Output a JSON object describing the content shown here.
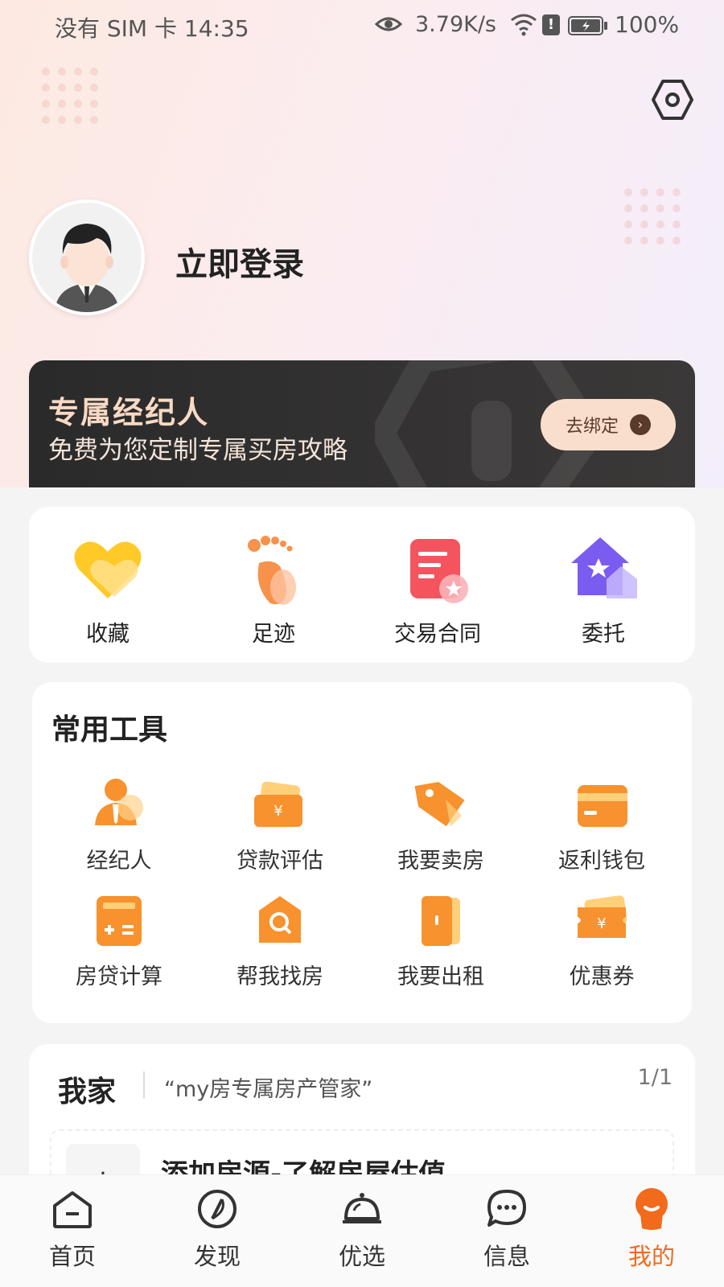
{
  "status_bar": {
    "carrier_time": "没有 SIM 卡 14:35",
    "net_speed": "3.79K/s",
    "battery": "100%",
    "alert_glyph": "!"
  },
  "profile": {
    "login_label": "立即登录"
  },
  "agent_banner": {
    "title": "专属经纪人",
    "subtitle": "免费为您定制专属买房攻略",
    "bind_label": "去绑定"
  },
  "quick_actions": [
    {
      "label": "收藏",
      "icon": "heart-icon"
    },
    {
      "label": "足迹",
      "icon": "footprint-icon"
    },
    {
      "label": "交易合同",
      "icon": "contract-icon"
    },
    {
      "label": "委托",
      "icon": "house-star-icon"
    }
  ],
  "tools": {
    "heading": "常用工具",
    "items": [
      {
        "label": "经纪人",
        "icon": "agent-icon"
      },
      {
        "label": "贷款评估",
        "icon": "loan-card-icon"
      },
      {
        "label": "我要卖房",
        "icon": "tag-icon"
      },
      {
        "label": "返利钱包",
        "icon": "wallet-icon"
      },
      {
        "label": "房贷计算",
        "icon": "calculator-icon"
      },
      {
        "label": "帮我找房",
        "icon": "search-house-icon"
      },
      {
        "label": "我要出租",
        "icon": "door-icon"
      },
      {
        "label": "优惠券",
        "icon": "coupon-icon"
      }
    ]
  },
  "my_home": {
    "title": "我家",
    "slogan": "“my房专属房产管家”",
    "pager": "1/1",
    "add_label": "添加房源-了解房屋估值",
    "plus_glyph": "+"
  },
  "tabbar": [
    {
      "label": "首页",
      "icon": "home-icon"
    },
    {
      "label": "发现",
      "icon": "compass-icon"
    },
    {
      "label": "优选",
      "icon": "service-bell-icon"
    },
    {
      "label": "信息",
      "icon": "chat-icon"
    },
    {
      "label": "我的",
      "icon": "me-icon"
    }
  ],
  "colors": {
    "accent": "#f26a1b",
    "banner_bg": "#2a2a2a",
    "banner_title": "#f8d9c3"
  }
}
